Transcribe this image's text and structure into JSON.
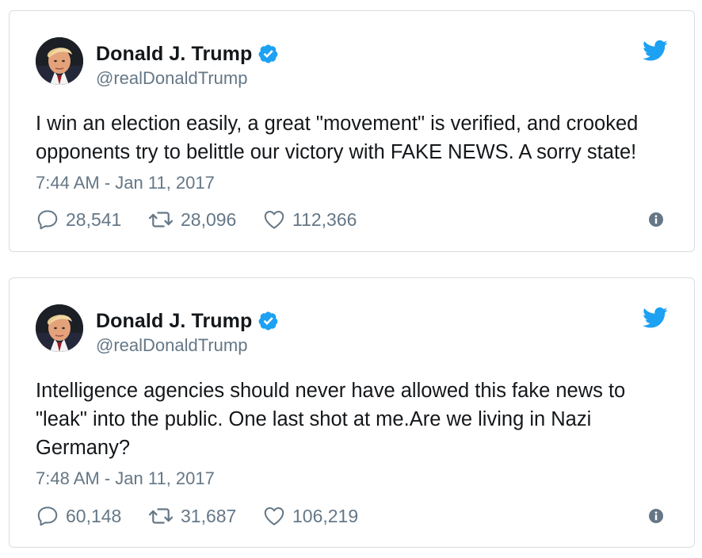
{
  "tweets": [
    {
      "author_name": "Donald J. Trump",
      "handle": "@realDonaldTrump",
      "text": "I win an election easily, a great \"movement\" is verified, and crooked\nopponents try to belittle our victory with FAKE NEWS. A sorry state!",
      "timestamp": "7:44 AM - Jan 11, 2017",
      "replies": "28,541",
      "retweets": "28,096",
      "likes": "112,366"
    },
    {
      "author_name": "Donald J. Trump",
      "handle": "@realDonaldTrump",
      "text": "Intelligence agencies should never have allowed this fake news to\n\"leak\" into the public. One last shot at me.Are we living in Nazi\nGermany?",
      "timestamp": "7:48 AM - Jan 11, 2017",
      "replies": "60,148",
      "retweets": "31,687",
      "likes": "106,219"
    }
  ],
  "icons": {
    "verified": "verified-badge-icon",
    "brand": "twitter-bird-icon",
    "reply": "reply-icon",
    "retweet": "retweet-icon",
    "like": "heart-icon",
    "info": "info-icon"
  },
  "colors": {
    "brand_blue": "#1da1f2",
    "text": "#14171a",
    "muted": "#657786",
    "border": "#d8dde1"
  }
}
